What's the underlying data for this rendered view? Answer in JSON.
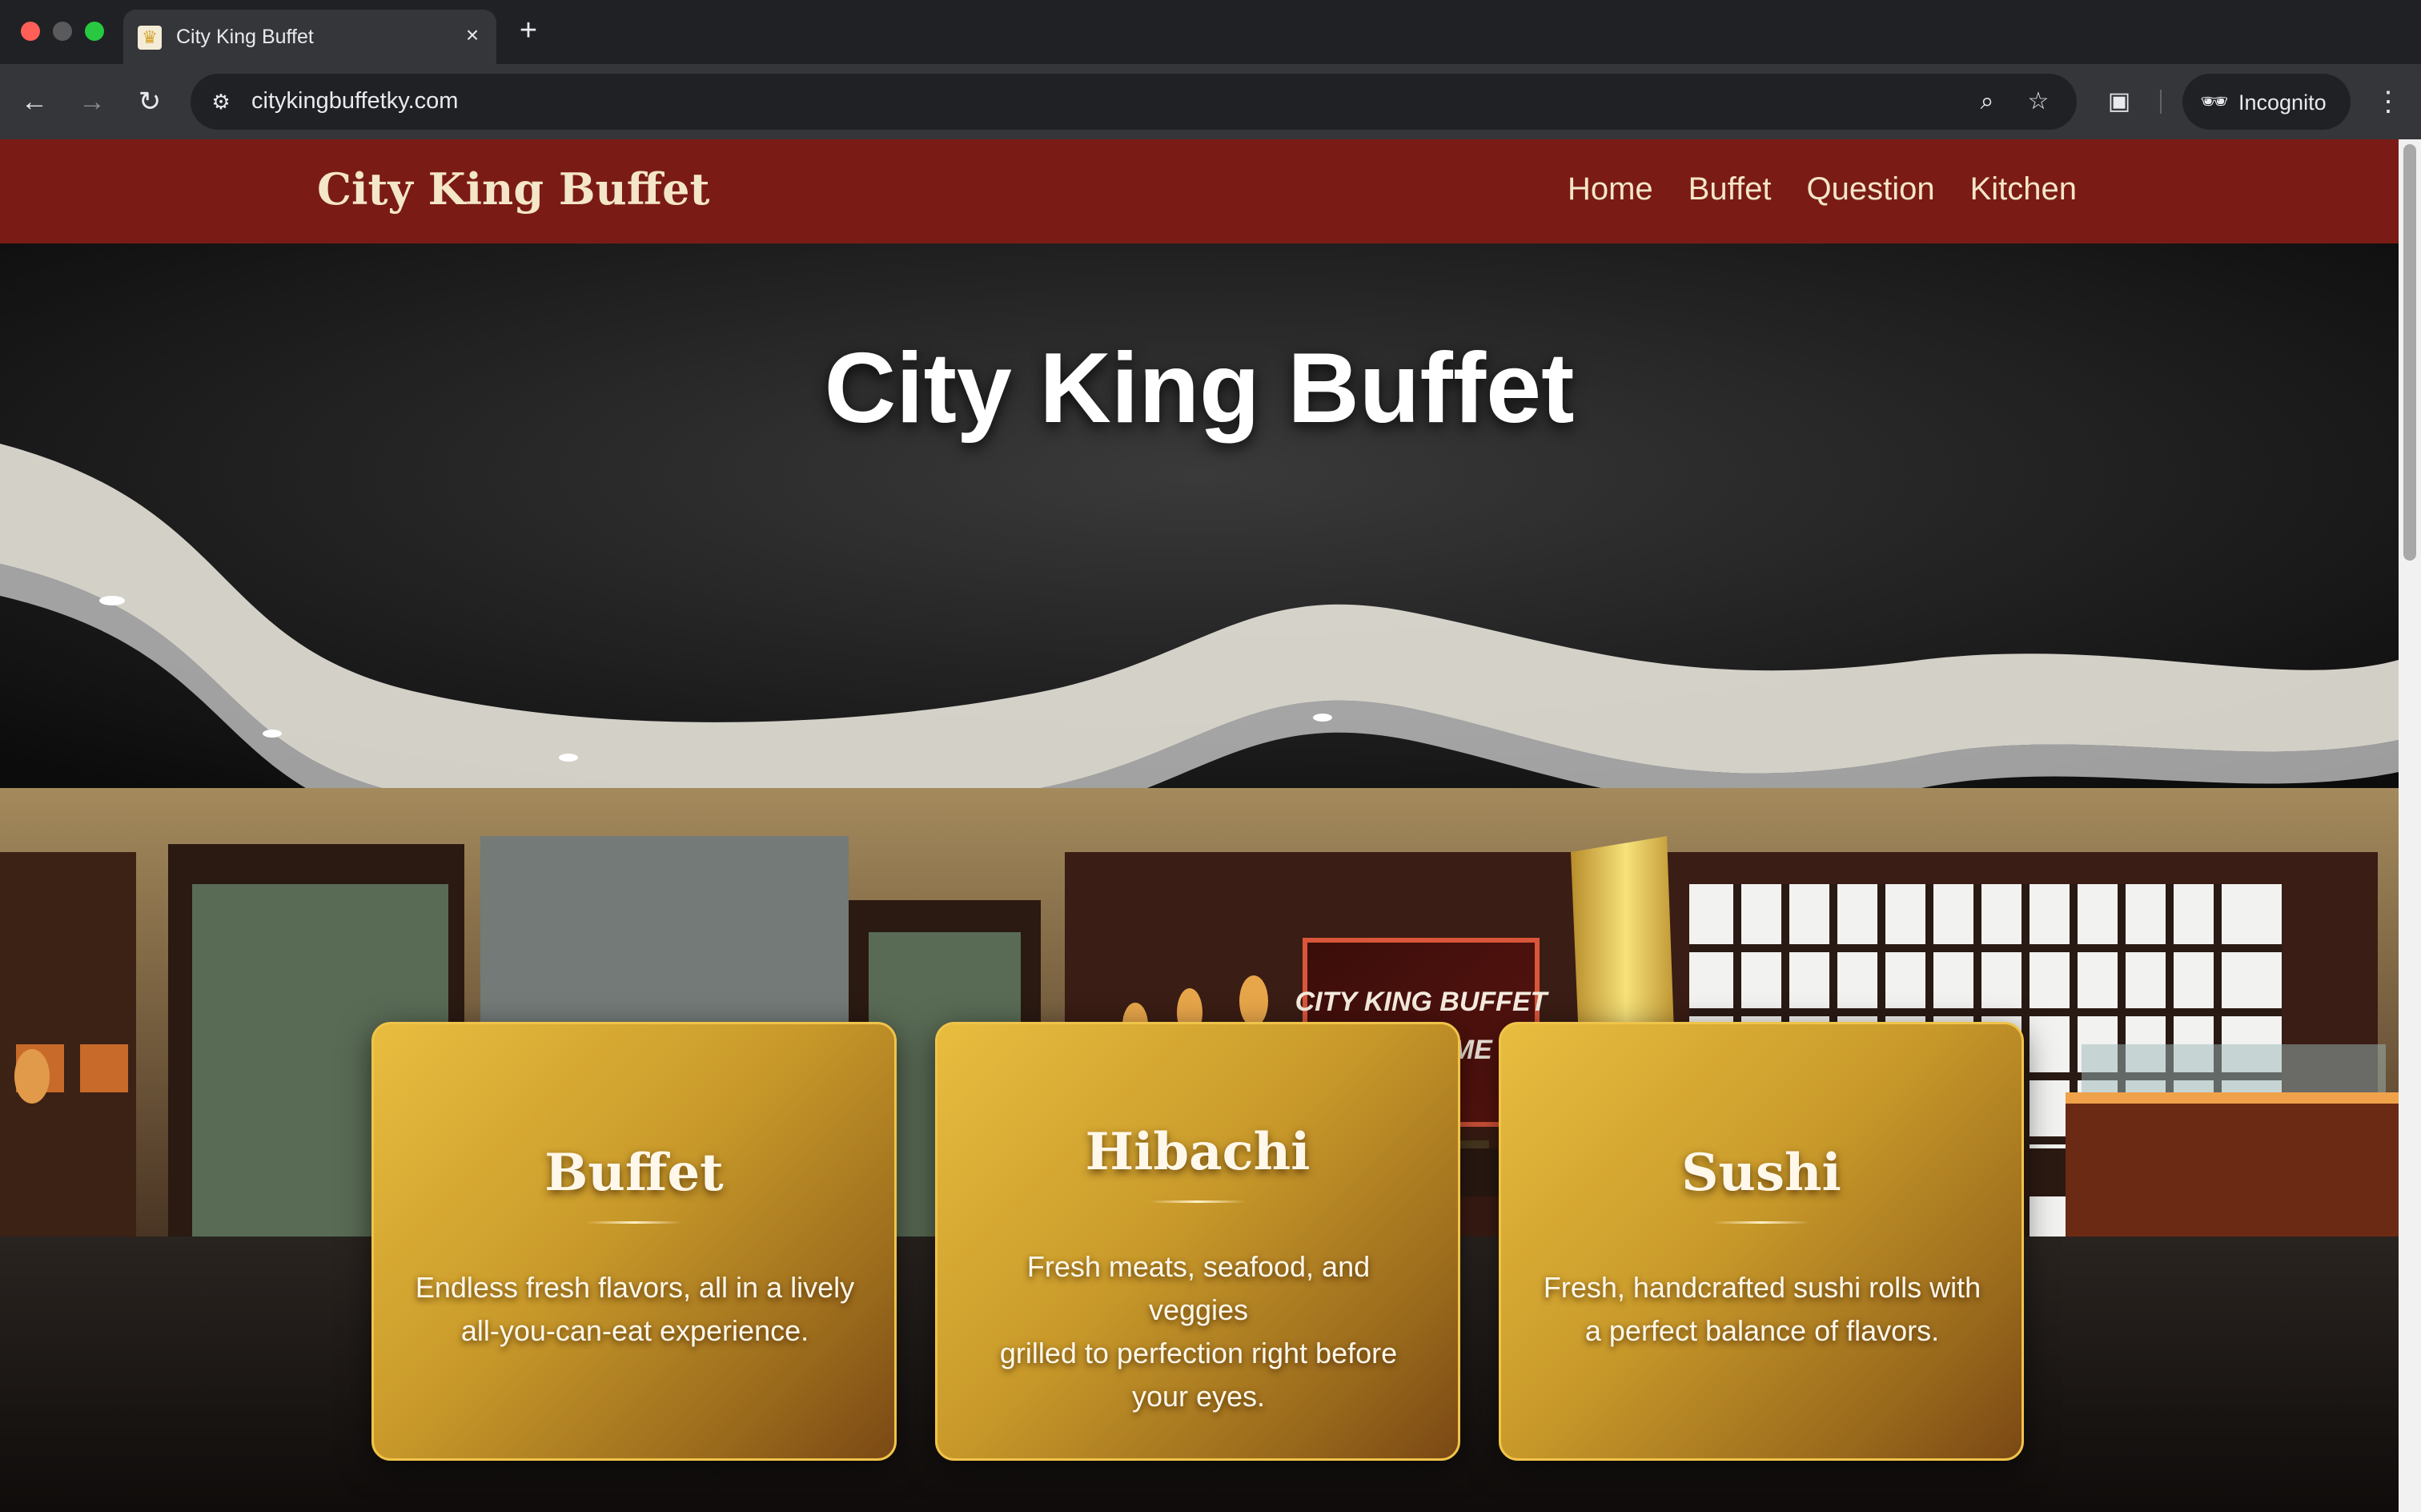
{
  "browser": {
    "tab_title": "City King Buffet",
    "tab_favicon": "crown-favicon-icon",
    "close_glyph": "×",
    "new_tab_glyph": "+",
    "url": "citykingbuffetky.com",
    "profile_label": "Incognito",
    "icons": {
      "back": "←",
      "forward": "→",
      "reload": "↻",
      "site_info": "⚙",
      "zoom": "⌕",
      "bookmark": "☆",
      "media": "▣",
      "incognito": "🕶",
      "menu": "⋮"
    }
  },
  "site": {
    "logo": "City King Buffet",
    "nav": [
      "Home",
      "Buffet",
      "Question",
      "Kitchen"
    ]
  },
  "hero": {
    "title": "City King Buffet",
    "sign_line1": "CITY KING BUFFET",
    "sign_line2": "WELCOME"
  },
  "cards": [
    {
      "title": "Buffet",
      "text_lines": [
        "Endless fresh flavors, all in a lively",
        "all-you-can-eat experience."
      ]
    },
    {
      "title": "Hibachi",
      "text_lines": [
        "Fresh meats, seafood, and veggies",
        "grilled to perfection right before",
        "your eyes."
      ]
    },
    {
      "title": "Sushi",
      "text_lines": [
        "Fresh, handcrafted sushi rolls with",
        "a perfect balance of flavors."
      ]
    }
  ],
  "colors": {
    "header_red": "#7b1b15",
    "card_gold": "#d4a43a",
    "card_border": "#f0c34a"
  }
}
